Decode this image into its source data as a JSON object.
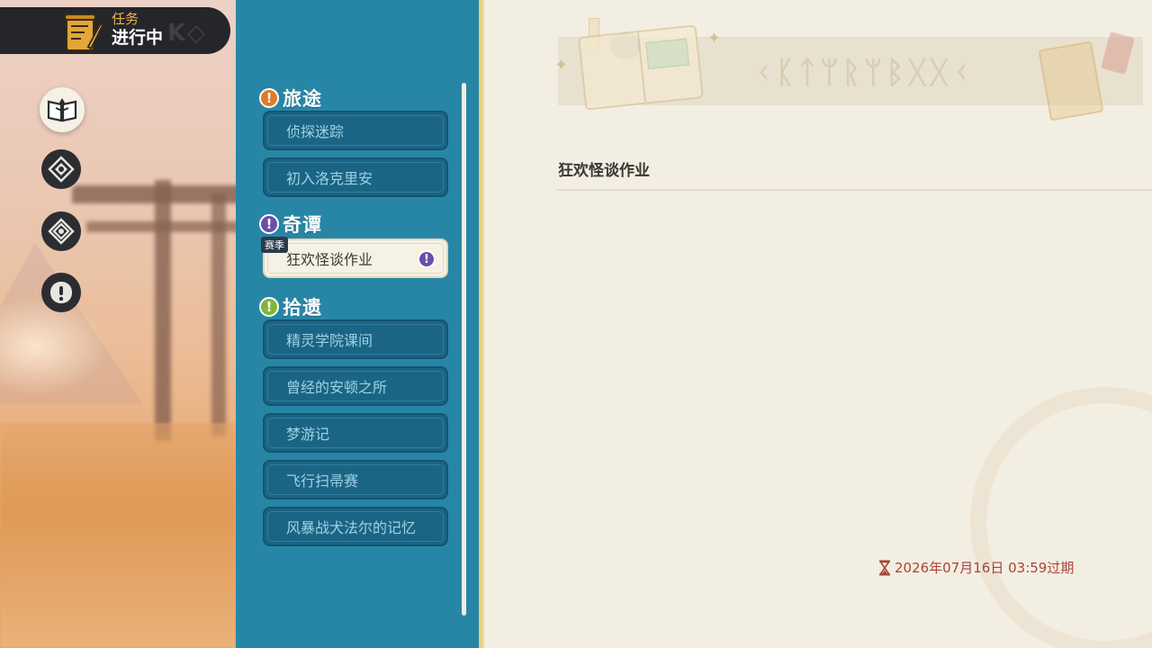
{
  "header": {
    "label": "任务",
    "status": "进行中"
  },
  "side_icons": [
    {
      "icon": "quest-book-icon",
      "active": true
    },
    {
      "icon": "compass-icon",
      "active": false
    },
    {
      "icon": "diamond-icon",
      "active": false
    },
    {
      "icon": "exclamation-icon",
      "active": false
    }
  ],
  "categories": [
    {
      "name": "旅途",
      "badge": "!",
      "badge_color": "#e07a24",
      "items": [
        {
          "label": "侦探迷踪"
        },
        {
          "label": "初入洛克里安"
        }
      ]
    },
    {
      "name": "奇谭",
      "badge": "!",
      "badge_color": "#6a4ea8",
      "items": [
        {
          "label": "狂欢怪谈作业",
          "tag": "赛季",
          "selected": true,
          "mark": "!"
        }
      ]
    },
    {
      "name": "拾遗",
      "badge": "!",
      "badge_color": "#7fb63a",
      "items": [
        {
          "label": "精灵学院课间"
        },
        {
          "label": "曾经的安顿之所"
        },
        {
          "label": "梦游记"
        },
        {
          "label": "飞行扫帚赛"
        },
        {
          "label": "风暴战犬法尔的记忆"
        }
      ]
    }
  ],
  "detail": {
    "title": "狂欢怪谈作业",
    "expire_text": "2026年07月16日 03:59过期"
  },
  "colors": {
    "list_bg": "#2786a6",
    "item_bg": "#1b6584",
    "selected_bg": "#f6f1e5",
    "expire": "#a8443a"
  }
}
